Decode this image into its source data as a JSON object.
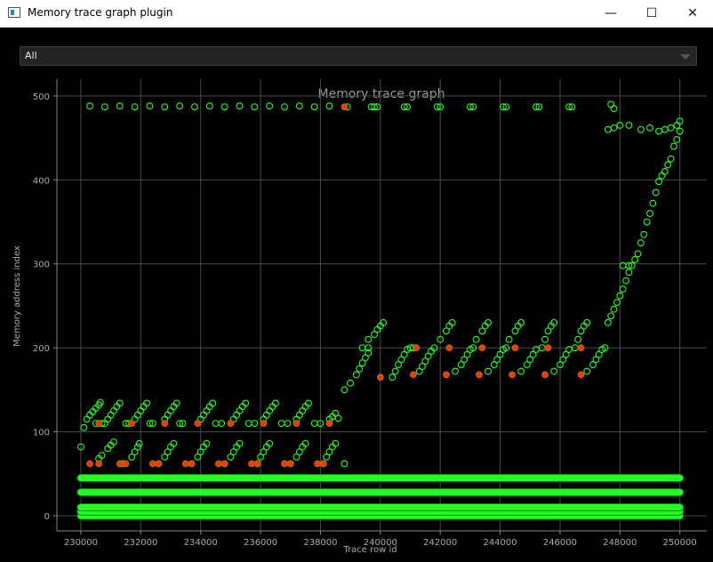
{
  "window": {
    "title": "Memory trace graph plugin",
    "controls": {
      "minimize": "—",
      "maximize": "☐",
      "close": "✕"
    }
  },
  "filter": {
    "selected": "All"
  },
  "chart_data": {
    "type": "scatter",
    "title": "Memory trace graph",
    "xlabel": "Trace row id",
    "ylabel": "Memory address index",
    "xlim": [
      229200,
      250900
    ],
    "ylim": [
      -18,
      520
    ],
    "xticks": [
      230000,
      232000,
      234000,
      236000,
      238000,
      240000,
      242000,
      244000,
      246000,
      248000,
      250000
    ],
    "yticks": [
      0,
      100,
      200,
      300,
      400,
      500
    ],
    "grid": true,
    "colors": {
      "read": "#22ff22",
      "write": "#ff3300",
      "background": "#000000",
      "grid": "#4a4a4a",
      "text": "#aaaaaa"
    },
    "series": [
      {
        "marker": "circle",
        "points": [
          [
            230000,
            82
          ],
          [
            230100,
            105
          ],
          [
            230200,
            115
          ],
          [
            230300,
            120
          ],
          [
            230400,
            124
          ],
          [
            230500,
            128
          ],
          [
            230600,
            132
          ],
          [
            230650,
            135
          ],
          [
            230500,
            110
          ],
          [
            230700,
            110
          ],
          [
            230800,
            110
          ],
          [
            230600,
            68
          ],
          [
            230700,
            72
          ],
          [
            230900,
            80
          ],
          [
            231000,
            84
          ],
          [
            231100,
            88
          ],
          [
            230900,
            115
          ],
          [
            231000,
            120
          ],
          [
            231100,
            125
          ],
          [
            231200,
            130
          ],
          [
            231300,
            134
          ],
          [
            231500,
            110
          ],
          [
            231600,
            110
          ],
          [
            231400,
            62
          ],
          [
            231700,
            70
          ],
          [
            231800,
            76
          ],
          [
            231900,
            82
          ],
          [
            231950,
            86
          ],
          [
            231800,
            115
          ],
          [
            231900,
            120
          ],
          [
            232000,
            125
          ],
          [
            232100,
            130
          ],
          [
            232200,
            134
          ],
          [
            232300,
            110
          ],
          [
            232400,
            110
          ],
          [
            232600,
            62
          ],
          [
            232800,
            70
          ],
          [
            232900,
            76
          ],
          [
            233000,
            82
          ],
          [
            233100,
            86
          ],
          [
            232800,
            115
          ],
          [
            232900,
            120
          ],
          [
            233000,
            125
          ],
          [
            233100,
            130
          ],
          [
            233200,
            134
          ],
          [
            233300,
            110
          ],
          [
            233400,
            110
          ],
          [
            233700,
            62
          ],
          [
            233900,
            70
          ],
          [
            234000,
            76
          ],
          [
            234100,
            82
          ],
          [
            234200,
            86
          ],
          [
            234000,
            115
          ],
          [
            234100,
            120
          ],
          [
            234200,
            125
          ],
          [
            234300,
            130
          ],
          [
            234400,
            134
          ],
          [
            234500,
            110
          ],
          [
            234700,
            110
          ],
          [
            234800,
            62
          ],
          [
            235000,
            70
          ],
          [
            235100,
            76
          ],
          [
            235200,
            82
          ],
          [
            235300,
            86
          ],
          [
            235100,
            115
          ],
          [
            235200,
            120
          ],
          [
            235300,
            125
          ],
          [
            235400,
            130
          ],
          [
            235500,
            134
          ],
          [
            235600,
            110
          ],
          [
            235800,
            110
          ],
          [
            235900,
            62
          ],
          [
            236000,
            70
          ],
          [
            236100,
            76
          ],
          [
            236200,
            82
          ],
          [
            236300,
            86
          ],
          [
            236100,
            115
          ],
          [
            236200,
            120
          ],
          [
            236300,
            125
          ],
          [
            236400,
            130
          ],
          [
            236500,
            134
          ],
          [
            236700,
            110
          ],
          [
            236900,
            110
          ],
          [
            237000,
            62
          ],
          [
            237200,
            70
          ],
          [
            237300,
            76
          ],
          [
            237400,
            82
          ],
          [
            237500,
            86
          ],
          [
            237200,
            115
          ],
          [
            237300,
            120
          ],
          [
            237400,
            125
          ],
          [
            237500,
            130
          ],
          [
            237600,
            134
          ],
          [
            237800,
            110
          ],
          [
            238000,
            110
          ],
          [
            238100,
            62
          ],
          [
            238200,
            70
          ],
          [
            238300,
            76
          ],
          [
            238400,
            82
          ],
          [
            238500,
            86
          ],
          [
            238300,
            115
          ],
          [
            238400,
            118
          ],
          [
            238500,
            122
          ],
          [
            238600,
            116
          ],
          [
            238800,
            62
          ],
          [
            238800,
            150
          ],
          [
            239000,
            158
          ],
          [
            239200,
            168
          ],
          [
            239300,
            175
          ],
          [
            239400,
            182
          ],
          [
            239500,
            188
          ],
          [
            239600,
            194
          ],
          [
            239400,
            200
          ],
          [
            239600,
            200
          ],
          [
            239600,
            210
          ],
          [
            239800,
            216
          ],
          [
            239900,
            222
          ],
          [
            240000,
            226
          ],
          [
            240100,
            230
          ],
          [
            240400,
            165
          ],
          [
            240500,
            172
          ],
          [
            240600,
            180
          ],
          [
            240700,
            186
          ],
          [
            240800,
            192
          ],
          [
            240900,
            198
          ],
          [
            241000,
            200
          ],
          [
            241100,
            200
          ],
          [
            241300,
            172
          ],
          [
            241400,
            178
          ],
          [
            241500,
            184
          ],
          [
            241600,
            190
          ],
          [
            241700,
            196
          ],
          [
            241800,
            200
          ],
          [
            242000,
            210
          ],
          [
            242200,
            220
          ],
          [
            242300,
            226
          ],
          [
            242400,
            230
          ],
          [
            242500,
            172
          ],
          [
            242700,
            180
          ],
          [
            242800,
            186
          ],
          [
            242900,
            192
          ],
          [
            243000,
            198
          ],
          [
            243100,
            200
          ],
          [
            243200,
            210
          ],
          [
            243400,
            220
          ],
          [
            243500,
            226
          ],
          [
            243600,
            230
          ],
          [
            243600,
            172
          ],
          [
            243800,
            180
          ],
          [
            243900,
            186
          ],
          [
            244000,
            192
          ],
          [
            244100,
            198
          ],
          [
            244200,
            200
          ],
          [
            244300,
            210
          ],
          [
            244500,
            220
          ],
          [
            244600,
            226
          ],
          [
            244700,
            230
          ],
          [
            244700,
            172
          ],
          [
            244900,
            180
          ],
          [
            245000,
            186
          ],
          [
            245100,
            192
          ],
          [
            245200,
            198
          ],
          [
            245400,
            200
          ],
          [
            245500,
            210
          ],
          [
            245600,
            220
          ],
          [
            245700,
            226
          ],
          [
            245800,
            230
          ],
          [
            245800,
            172
          ],
          [
            246000,
            180
          ],
          [
            246100,
            186
          ],
          [
            246200,
            192
          ],
          [
            246300,
            198
          ],
          [
            246500,
            200
          ],
          [
            246600,
            210
          ],
          [
            246700,
            220
          ],
          [
            246800,
            226
          ],
          [
            246900,
            230
          ],
          [
            246900,
            172
          ],
          [
            247100,
            180
          ],
          [
            247200,
            186
          ],
          [
            247300,
            192
          ],
          [
            247400,
            198
          ],
          [
            247500,
            200
          ],
          [
            247600,
            230
          ],
          [
            247700,
            238
          ],
          [
            247800,
            246
          ],
          [
            247900,
            254
          ],
          [
            248000,
            262
          ],
          [
            248100,
            270
          ],
          [
            248200,
            280
          ],
          [
            248300,
            290
          ],
          [
            248400,
            298
          ],
          [
            248500,
            305
          ],
          [
            248600,
            312
          ],
          [
            248700,
            325
          ],
          [
            248800,
            335
          ],
          [
            248900,
            350
          ],
          [
            249000,
            360
          ],
          [
            249100,
            372
          ],
          [
            249200,
            385
          ],
          [
            249300,
            398
          ],
          [
            249400,
            405
          ],
          [
            249500,
            410
          ],
          [
            249600,
            418
          ],
          [
            249700,
            425
          ],
          [
            249800,
            440
          ],
          [
            249900,
            448
          ],
          [
            250000,
            458
          ],
          [
            248100,
            298
          ],
          [
            248300,
            298
          ],
          [
            247600,
            460
          ],
          [
            247800,
            462
          ],
          [
            248000,
            465
          ],
          [
            248300,
            465
          ],
          [
            248700,
            460
          ],
          [
            249000,
            462
          ],
          [
            249300,
            458
          ],
          [
            249500,
            460
          ],
          [
            249700,
            462
          ],
          [
            249900,
            465
          ],
          [
            250000,
            470
          ],
          [
            247700,
            490
          ],
          [
            247800,
            485
          ],
          [
            230300,
            488
          ],
          [
            230800,
            487
          ],
          [
            231300,
            488
          ],
          [
            231800,
            487
          ],
          [
            232300,
            488
          ],
          [
            232800,
            487
          ],
          [
            233300,
            488
          ],
          [
            233800,
            487
          ],
          [
            234300,
            488
          ],
          [
            234800,
            487
          ],
          [
            235300,
            488
          ],
          [
            235800,
            487
          ],
          [
            236300,
            488
          ],
          [
            236800,
            487
          ],
          [
            237300,
            488
          ],
          [
            237800,
            487
          ],
          [
            238300,
            488
          ],
          [
            238900,
            487
          ],
          [
            239700,
            487
          ],
          [
            239800,
            487
          ],
          [
            239900,
            487
          ],
          [
            240800,
            487
          ],
          [
            240900,
            487
          ],
          [
            241900,
            487
          ],
          [
            242000,
            487
          ],
          [
            243000,
            487
          ],
          [
            243100,
            487
          ],
          [
            244100,
            487
          ],
          [
            244200,
            487
          ],
          [
            245200,
            487
          ],
          [
            245300,
            487
          ],
          [
            246300,
            487
          ],
          [
            246400,
            487
          ]
        ]
      },
      {
        "marker": "circle",
        "points": [
          [
            230300,
            62
          ],
          [
            230600,
            62
          ],
          [
            231300,
            62
          ],
          [
            231500,
            62
          ],
          [
            232400,
            62
          ],
          [
            232600,
            62
          ],
          [
            233500,
            62
          ],
          [
            233700,
            62
          ],
          [
            234600,
            62
          ],
          [
            234800,
            62
          ],
          [
            235700,
            62
          ],
          [
            235900,
            62
          ],
          [
            236800,
            62
          ],
          [
            237000,
            62
          ],
          [
            237900,
            62
          ],
          [
            238100,
            62
          ],
          [
            230600,
            110
          ],
          [
            231700,
            110
          ],
          [
            232800,
            110
          ],
          [
            233900,
            110
          ],
          [
            235000,
            110
          ],
          [
            236100,
            110
          ],
          [
            237200,
            110
          ],
          [
            238300,
            110
          ],
          [
            240000,
            165
          ],
          [
            241100,
            168
          ],
          [
            242200,
            168
          ],
          [
            243300,
            168
          ],
          [
            244400,
            168
          ],
          [
            245500,
            168
          ],
          [
            246700,
            168
          ],
          [
            238800,
            487
          ],
          [
            241200,
            200
          ],
          [
            242300,
            200
          ],
          [
            243400,
            200
          ],
          [
            244500,
            200
          ],
          [
            245600,
            200
          ],
          [
            246700,
            200
          ]
        ]
      }
    ],
    "bands": [
      0,
      5,
      10,
      28,
      45
    ]
  }
}
